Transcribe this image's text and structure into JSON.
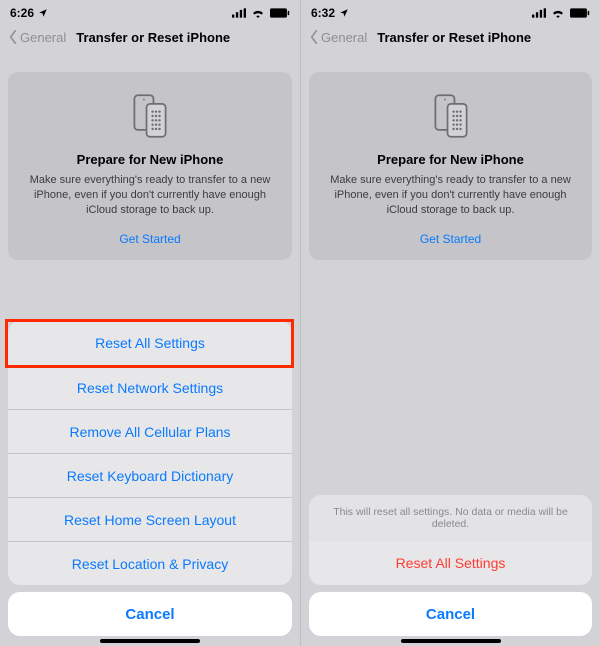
{
  "left": {
    "status": {
      "time": "6:26"
    },
    "nav": {
      "back": "General",
      "title": "Transfer or Reset iPhone"
    },
    "card": {
      "title": "Prepare for New iPhone",
      "body": "Make sure everything's ready to transfer to a new iPhone, even if you don't currently have enough iCloud storage to back up.",
      "cta": "Get Started"
    },
    "sheet": {
      "items": [
        "Reset All Settings",
        "Reset Network Settings",
        "Remove All Cellular Plans",
        "Reset Keyboard Dictionary",
        "Reset Home Screen Layout",
        "Reset Location & Privacy"
      ],
      "cancel": "Cancel"
    }
  },
  "right": {
    "status": {
      "time": "6:32"
    },
    "nav": {
      "back": "General",
      "title": "Transfer or Reset iPhone"
    },
    "card": {
      "title": "Prepare for New iPhone",
      "body": "Make sure everything's ready to transfer to a new iPhone, even if you don't currently have enough iCloud storage to back up.",
      "cta": "Get Started"
    },
    "sheet": {
      "message": "This will reset all settings. No data or media will be deleted.",
      "confirm": "Reset All Settings",
      "cancel": "Cancel"
    }
  }
}
